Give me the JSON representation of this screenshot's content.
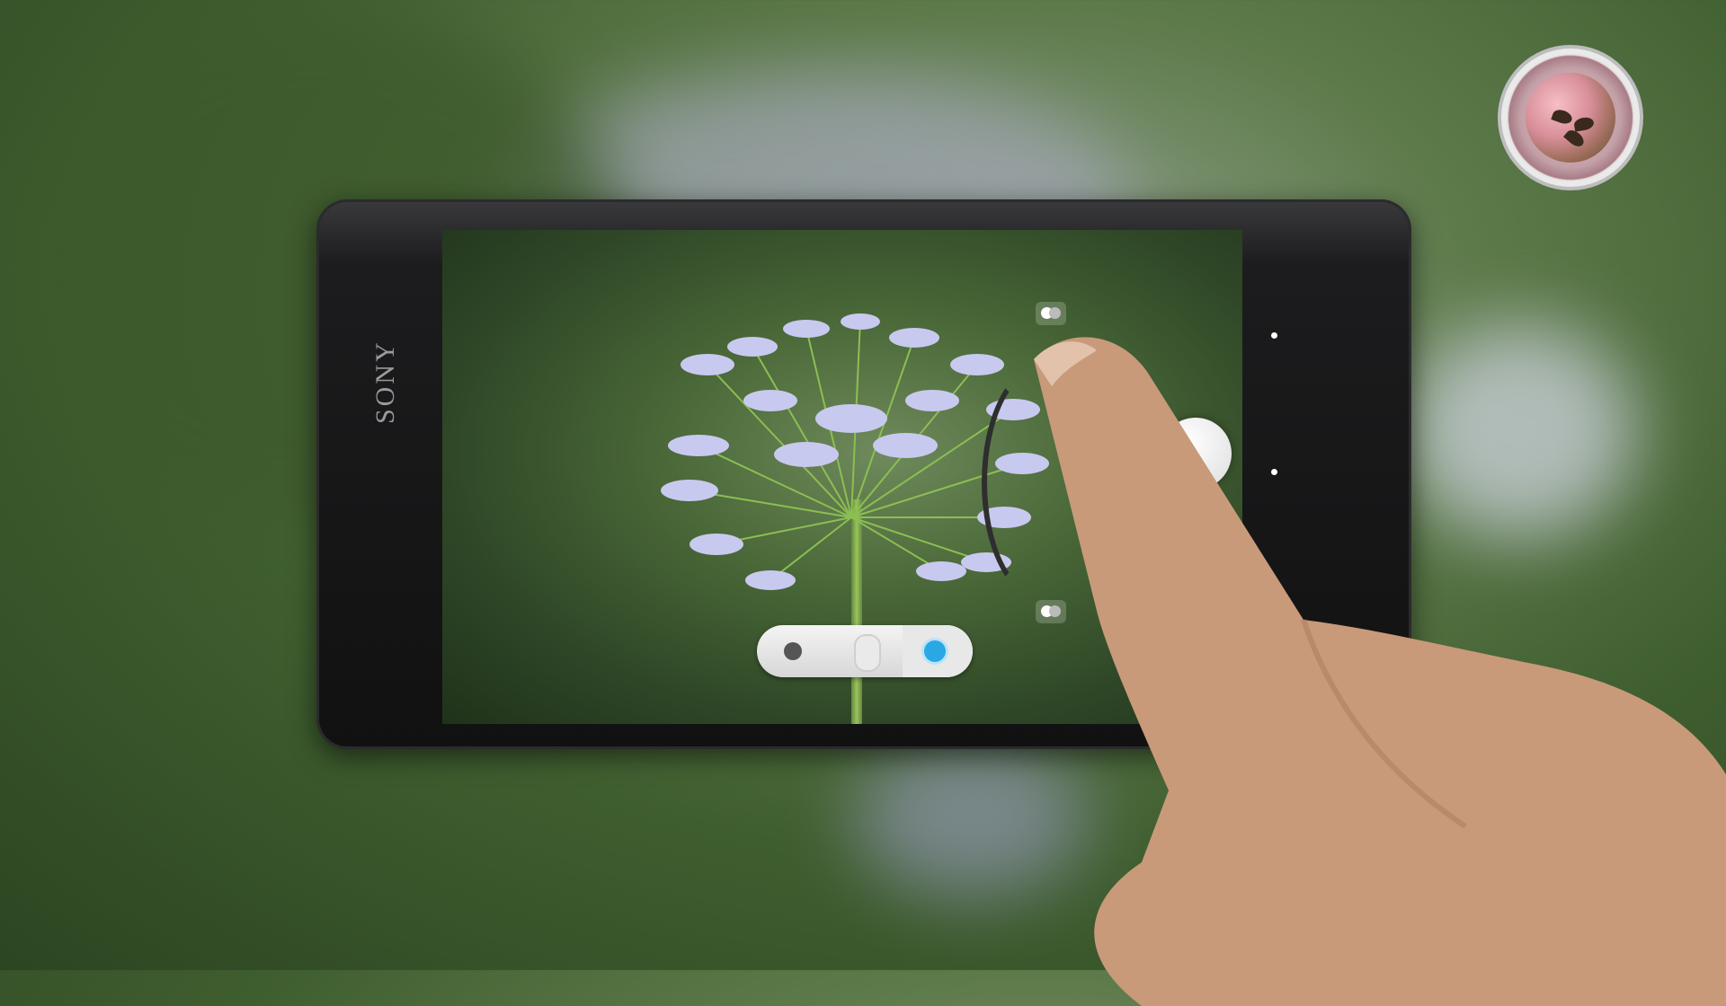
{
  "phone": {
    "brand": "SONY"
  },
  "colors": {
    "accent": "#2aa8e6",
    "slider_bg": "#e0e0e0"
  },
  "icons": [
    "aperture-icon",
    "shutter-button",
    "slider-dot",
    "logo-emblem"
  ]
}
